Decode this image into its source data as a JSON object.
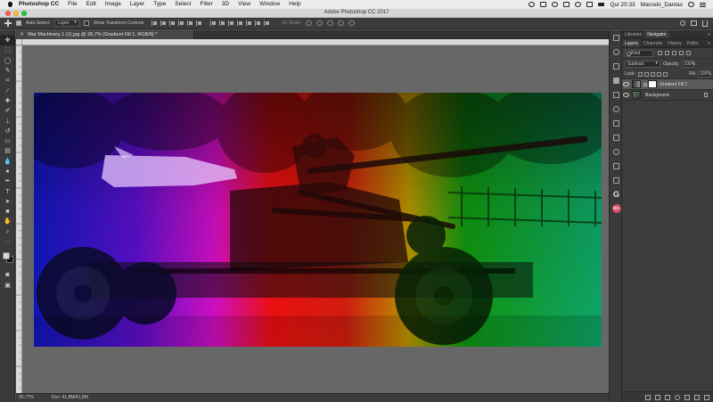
{
  "menubar": {
    "app_name": "Photoshop CC",
    "items": [
      "File",
      "Edit",
      "Image",
      "Layer",
      "Type",
      "Select",
      "Filter",
      "3D",
      "View",
      "Window",
      "Help"
    ],
    "clock": "Qui 20:33",
    "user": "Marcelo_Dantas"
  },
  "appbar": {
    "title": "Adobe Photoshop CC 2017"
  },
  "options": {
    "auto_select_label": "Auto-Select:",
    "auto_select_value": "Layer",
    "transform_label": "Show Transform Controls",
    "mode3d_label": "3D Mode:"
  },
  "document": {
    "tab_title": "War Machinery 1 (1).jpg @ 26,7% (Gradient Fill 1, RGB/8) *",
    "zoom": "26,77%",
    "doc_size": "Doc: 41,8M/41,8M"
  },
  "panels": {
    "top_tabs": [
      "Libraries",
      "Navigator"
    ],
    "layer_tabs": [
      "Layers",
      "Channels",
      "History",
      "Paths"
    ],
    "kind_label": "Kind",
    "blend_mode": "Subtract",
    "opacity_label": "Opacity:",
    "opacity_value": "100%",
    "lock_label": "Lock:",
    "fill_label": "Fill:",
    "fill_value": "100%",
    "layers": [
      {
        "name": "Gradient Fill 1",
        "selected": true
      },
      {
        "name": "Background",
        "selected": false
      }
    ]
  },
  "colors": {
    "foreground": "#d8d8d8",
    "background": "#111111",
    "gradient": [
      "#0a1cf0",
      "#ff00ff",
      "#ff0000",
      "#ffd800",
      "#00cc00",
      "#00cc99"
    ]
  }
}
